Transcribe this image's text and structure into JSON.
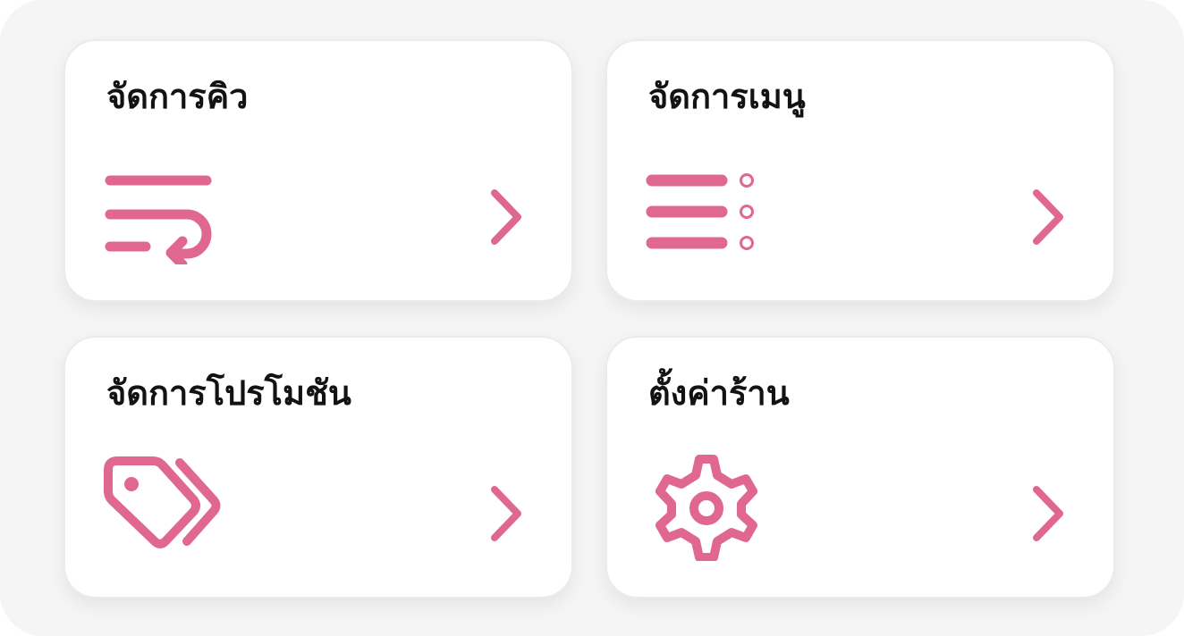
{
  "theme": {
    "accent": "#e0678f",
    "card_background": "#ffffff",
    "panel_background": "#f6f5f6",
    "text": "#121212"
  },
  "menu": {
    "items": [
      {
        "label": "จัดการคิว",
        "icon": "queue-wrap-icon"
      },
      {
        "label": "จัดการเมนู",
        "icon": "list-icon"
      },
      {
        "label": "จัดการโปรโมชัน",
        "icon": "tags-icon"
      },
      {
        "label": "ตั้งค่าร้าน",
        "icon": "gear-icon"
      }
    ],
    "chevron_icon": "chevron-right-icon"
  }
}
